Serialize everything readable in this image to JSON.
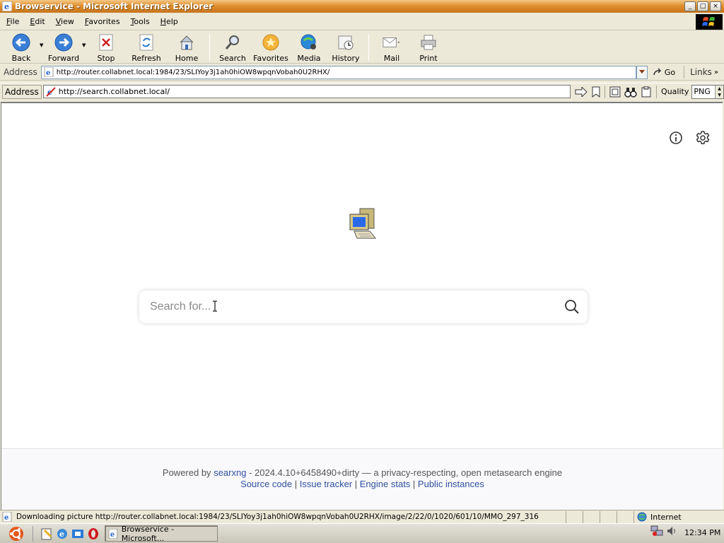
{
  "window": {
    "title": "Browservice - Microsoft Internet Explorer",
    "min": "_",
    "max": "□",
    "close": "×"
  },
  "menu": {
    "items": [
      {
        "label": "File",
        "u": "F",
        "rest": "ile"
      },
      {
        "label": "Edit",
        "u": "E",
        "rest": "dit"
      },
      {
        "label": "View",
        "u": "V",
        "rest": "iew"
      },
      {
        "label": "Favorites",
        "u": "F",
        "rest": "avorites"
      },
      {
        "label": "Tools",
        "u": "T",
        "rest": "ools"
      },
      {
        "label": "Help",
        "u": "H",
        "rest": "elp"
      }
    ]
  },
  "toolbar": {
    "back": "Back",
    "forward": "Forward",
    "stop": "Stop",
    "refresh": "Refresh",
    "home": "Home",
    "search": "Search",
    "favorites": "Favorites",
    "media": "Media",
    "history": "History",
    "mail": "Mail",
    "print": "Print"
  },
  "address1": {
    "label": "Address",
    "url": "http://router.collabnet.local:1984/23/SLIYoy3j1ah0hiOW8wpqnVobah0U2RHX/",
    "go": "Go",
    "links": "Links"
  },
  "address2": {
    "label": "Address",
    "url": "http://search.collabnet.local/",
    "quality_label": "Quality",
    "quality_value": "PNG"
  },
  "page": {
    "search_placeholder": "Search for...",
    "powered_by": "Powered by",
    "engine_name": "searxng",
    "engine_desc": "- 2024.4.10+6458490+dirty — a privacy-respecting, open metasearch engine",
    "links": [
      "Source code",
      "Issue tracker",
      "Engine stats",
      "Public instances"
    ]
  },
  "statusbar": {
    "text": "Downloading picture http://router.collabnet.local:1984/23/SLIYoy3j1ah0hiOW8wpqnVobah0U2RHX/image/2/22/0/1020/601/10/MMO_297_316",
    "zone": "Internet"
  },
  "taskbar": {
    "task_label": "Browservice - Microsoft...",
    "clock": "12:34 PM"
  }
}
